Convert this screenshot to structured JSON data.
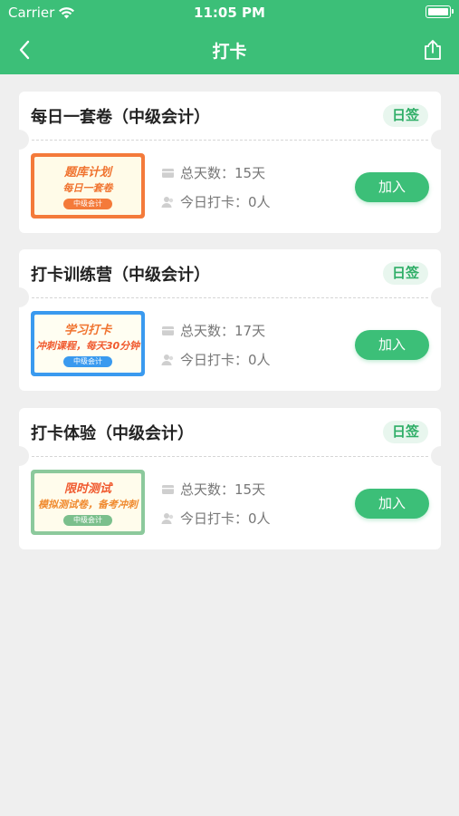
{
  "status_bar": {
    "carrier": "Carrier",
    "time": "11:05 PM"
  },
  "nav": {
    "title": "打卡"
  },
  "cards": [
    {
      "title": "每日一套卷（中级会计）",
      "tag": "日签",
      "thumb": {
        "line1": "题库计划",
        "line2": "每日一套卷",
        "pill": "中级会计"
      },
      "total_days": "总天数：15天",
      "today_checkin": "今日打卡：0人",
      "button": "加入"
    },
    {
      "title": "打卡训练营（中级会计）",
      "tag": "日签",
      "thumb": {
        "line1": "学习打卡",
        "line2": "冲刺课程，每天30分钟",
        "pill": "中级会计"
      },
      "total_days": "总天数：17天",
      "today_checkin": "今日打卡：0人",
      "button": "加入"
    },
    {
      "title": "打卡体验（中级会计）",
      "tag": "日签",
      "thumb": {
        "line1": "限时测试",
        "line2": "模拟测试卷，备考冲刺",
        "pill": "中级会计"
      },
      "total_days": "总天数：15天",
      "today_checkin": "今日打卡：0人",
      "button": "加入"
    }
  ],
  "colors": {
    "brand": "#3cbf78",
    "background": "#efefef",
    "tag_text": "#2fae67"
  }
}
